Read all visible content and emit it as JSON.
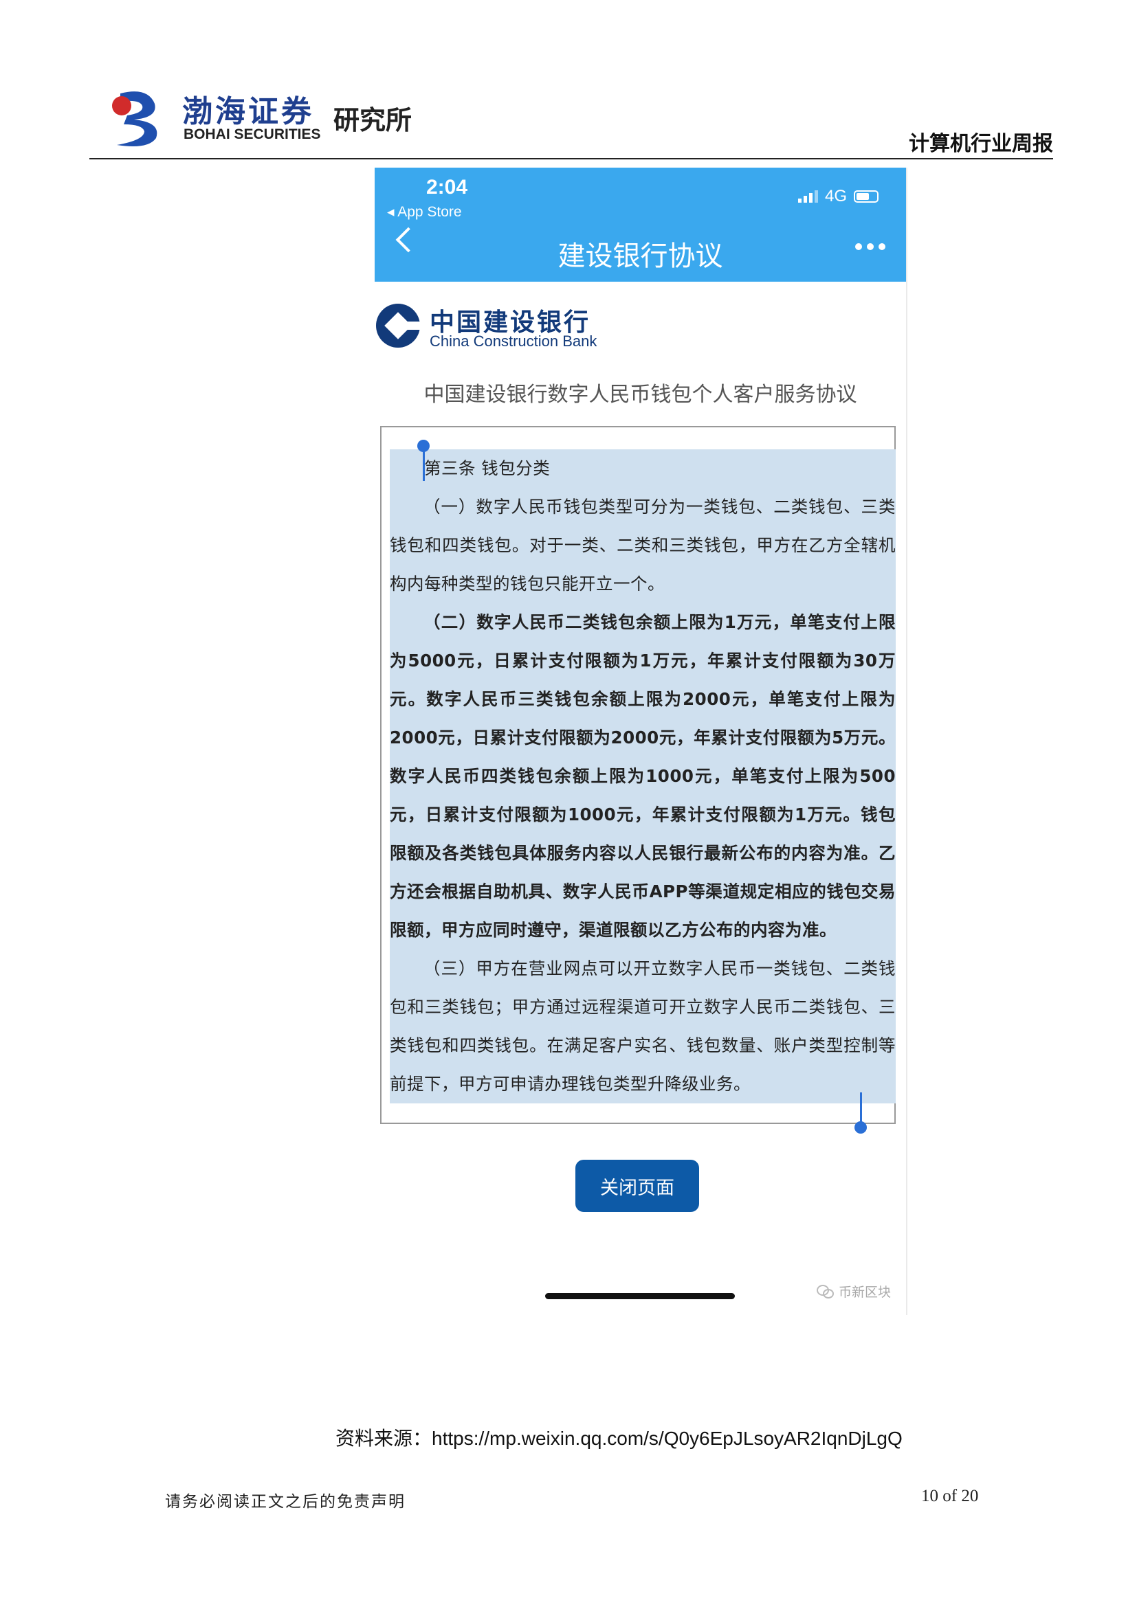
{
  "header": {
    "logo_cn": "渤海证券",
    "logo_en": "BOHAI SECURITIES",
    "logo_institute": "研究所",
    "report_type": "计算机行业周报"
  },
  "phone": {
    "status": {
      "time": "2:04",
      "back_app": "◂ App Store",
      "network": "4G"
    },
    "nav": {
      "title": "建设银行协议"
    },
    "bank": {
      "name_cn": "中国建设银行",
      "name_en": "China Construction Bank"
    },
    "agreement_title": "中国建设银行数字人民币钱包个人客户服务协议",
    "clause": {
      "heading": "第三条 钱包分类",
      "p1": "（一）数字人民币钱包类型可分为一类钱包、二类钱包、三类钱包和四类钱包。对于一类、二类和三类钱包，甲方在乙方全辖机构内每种类型的钱包只能开立一个。",
      "p2": "（二）数字人民币二类钱包余额上限为1万元，单笔支付上限为5000元，日累计支付限额为1万元，年累计支付限额为30万元。数字人民币三类钱包余额上限为2000元，单笔支付上限为2000元，日累计支付限额为2000元，年累计支付限额为5万元。数字人民币四类钱包余额上限为1000元，单笔支付上限为500元，日累计支付限额为1000元，年累计支付限额为1万元。钱包限额及各类钱包具体服务内容以人民银行最新公布的内容为准。乙方还会根据自助机具、数字人民币APP等渠道规定相应的钱包交易限额，甲方应同时遵守，渠道限额以乙方公布的内容为准。",
      "p3": "（三）甲方在营业网点可以开立数字人民币一类钱包、二类钱包和三类钱包；甲方通过远程渠道可开立数字人民币二类钱包、三类钱包和四类钱包。在满足客户实名、钱包数量、账户类型控制等前提下，甲方可申请办理钱包类型升降级业务。"
    },
    "close_button": "关闭页面",
    "watermark": "币新区块"
  },
  "source": {
    "label": "资料来源：",
    "url": "https://mp.weixin.qq.com/s/Q0y6EpJLsoyAR2IqnDjLgQ"
  },
  "footer": {
    "disclaimer": "请务必阅读正文之后的免责声明",
    "page": "10 of 20"
  },
  "colors": {
    "phone_header": "#3aa8ee",
    "selection": "#cfe0ef",
    "button": "#0d5aa7",
    "bank_blue": "#123a7a"
  }
}
